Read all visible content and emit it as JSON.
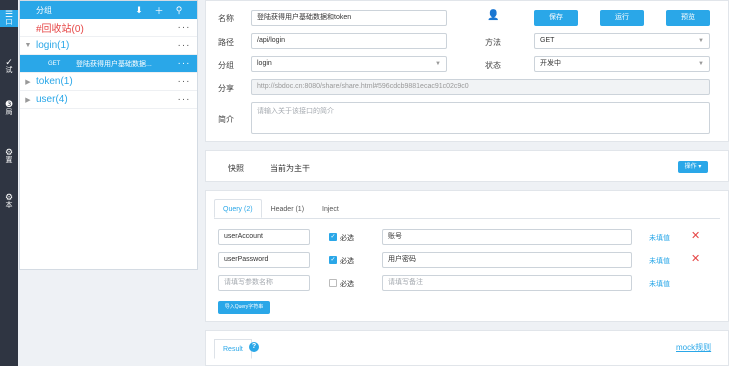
{
  "rail": [
    {
      "icon": "☰",
      "label": "口"
    },
    {
      "icon": "✓",
      "label": "试"
    },
    {
      "icon": "❸",
      "label": "局"
    },
    {
      "icon": "⚙",
      "label": "置"
    },
    {
      "icon": "⚙",
      "label": "本"
    }
  ],
  "tree": {
    "header_label": "分组",
    "icons": {
      "download": "download-icon",
      "add": "plus-icon",
      "search": "search-icon"
    },
    "items": [
      {
        "label": "#回收站(0)",
        "more": "···"
      },
      {
        "label": "login(1)",
        "more": "···"
      },
      {
        "method": "GET",
        "label": "登陆获得用户基础数据...",
        "more": "···"
      },
      {
        "label": "token(1)",
        "more": "···"
      },
      {
        "label": "user(4)",
        "more": "···"
      }
    ]
  },
  "form": {
    "name_label": "名称",
    "name_value": "登陆获得用户基础数据和token",
    "path_label": "路径",
    "path_value": "/api/login",
    "group_label": "分组",
    "group_value": "login",
    "share_label": "分享",
    "share_value": "http://sbdoc.cn:8080/share/share.html#596cdcb9881ecac91c02c9c0",
    "desc_label": "简介",
    "desc_placeholder": "请输入关于该接口的简介",
    "method_label": "方法",
    "method_value": "GET",
    "status_label": "状态",
    "status_value": "开发中",
    "save_label": "保存",
    "run_label": "运行",
    "preview_label": "预览"
  },
  "snapshot": {
    "snap_label": "快照",
    "branch_label": "当前为主干",
    "op_label": "操作 ▾"
  },
  "query": {
    "tabs": [
      "Query (2)",
      "Header (1)",
      "Inject"
    ],
    "rows": [
      {
        "name": "userAccount",
        "required_label": "必选",
        "checked": true,
        "remark": "账号",
        "fill_label": "未填值",
        "delete": "✕"
      },
      {
        "name": "userPassword",
        "required_label": "必选",
        "checked": true,
        "remark": "用户密码",
        "fill_label": "未填值",
        "delete": "✕"
      }
    ],
    "new_row": {
      "name_placeholder": "请填写参数名称",
      "required_label": "必选",
      "remark_placeholder": "请填写备注",
      "fill_label": "未填值"
    },
    "import_label": "导入Query字符串"
  },
  "result": {
    "tab_label": "Result",
    "help_icon": "?",
    "mock_label": "mock规则"
  },
  "colors": {
    "accent": "#2aa7e8",
    "danger": "#e64545",
    "rail": "#2f3542"
  }
}
